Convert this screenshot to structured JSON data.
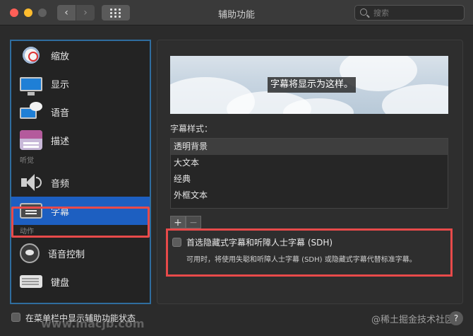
{
  "window": {
    "title": "辅助功能",
    "nav_back": "‹",
    "nav_forward": "›"
  },
  "search": {
    "placeholder": "搜索"
  },
  "sidebar": {
    "items": [
      {
        "label": "缩放",
        "icon": "zoom-icon"
      },
      {
        "label": "显示",
        "icon": "display-icon"
      },
      {
        "label": "语音",
        "icon": "speech-icon"
      },
      {
        "label": "描述",
        "icon": "description-icon"
      }
    ],
    "section_hearing": "听觉",
    "hearing_items": [
      {
        "label": "音频",
        "icon": "audio-icon"
      },
      {
        "label": "字幕",
        "icon": "captions-icon",
        "selected": true
      }
    ],
    "section_action": "动作",
    "action_items": [
      {
        "label": "语音控制",
        "icon": "voice-control-icon"
      },
      {
        "label": "键盘",
        "icon": "keyboard-icon"
      }
    ]
  },
  "captions": {
    "preview_text": "字幕将显示为这样。",
    "style_label": "字幕样式：",
    "styles": [
      "透明背景",
      "大文本",
      "经典",
      "外框文本"
    ],
    "selected_style": "透明背景",
    "add_label": "+",
    "remove_label": "−",
    "sdh_title": "首选隐藏式字幕和听障人士字幕 (SDH)",
    "sdh_desc": "可用时，将使用失聪和听障人士字幕 (SDH) 或隐藏式字幕代替标准字幕。",
    "sdh_checked": false
  },
  "footer": {
    "menu_bar_label": "在菜单栏中显示辅助功能状态",
    "help_label": "?",
    "watermark": "@稀土掘金技术社区",
    "watermark2": "www.macjb.com"
  },
  "colors": {
    "accent": "#1d5fc1",
    "highlight_outline": "#e84a4a",
    "sidebar_border": "#2f6d9e"
  }
}
